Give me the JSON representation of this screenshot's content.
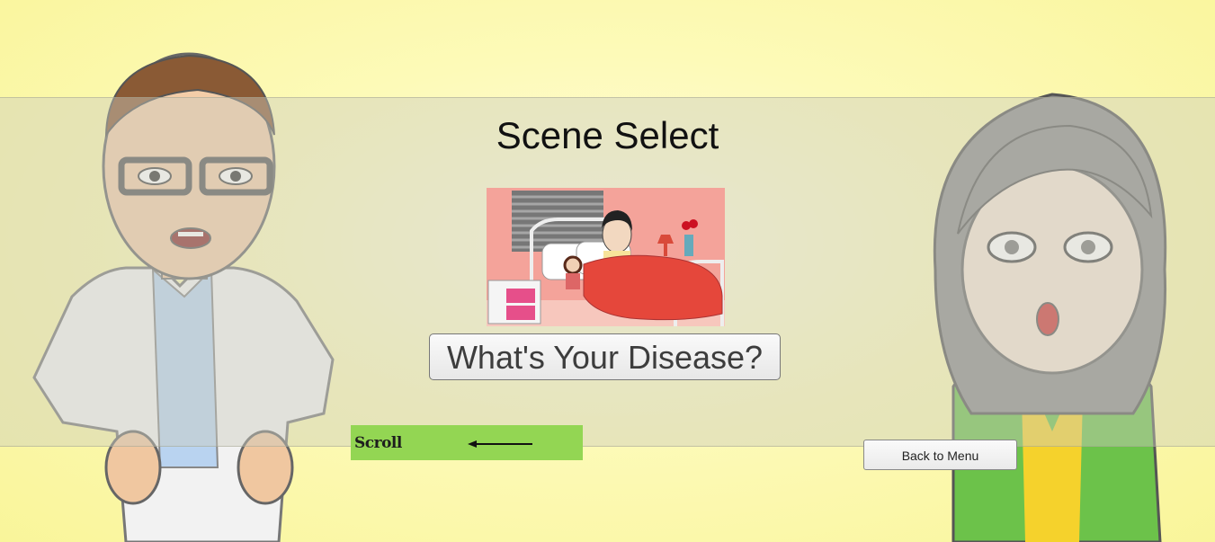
{
  "title": "Scene Select",
  "scene": {
    "label": "What's Your Disease?"
  },
  "scroll": {
    "label": "Scroll"
  },
  "back": {
    "label": "Back to Menu"
  },
  "colors": {
    "background": "#fdfab8",
    "scroll_bar": "#93d653"
  },
  "icons": {
    "scroll_arrow": "left-arrow-icon"
  }
}
